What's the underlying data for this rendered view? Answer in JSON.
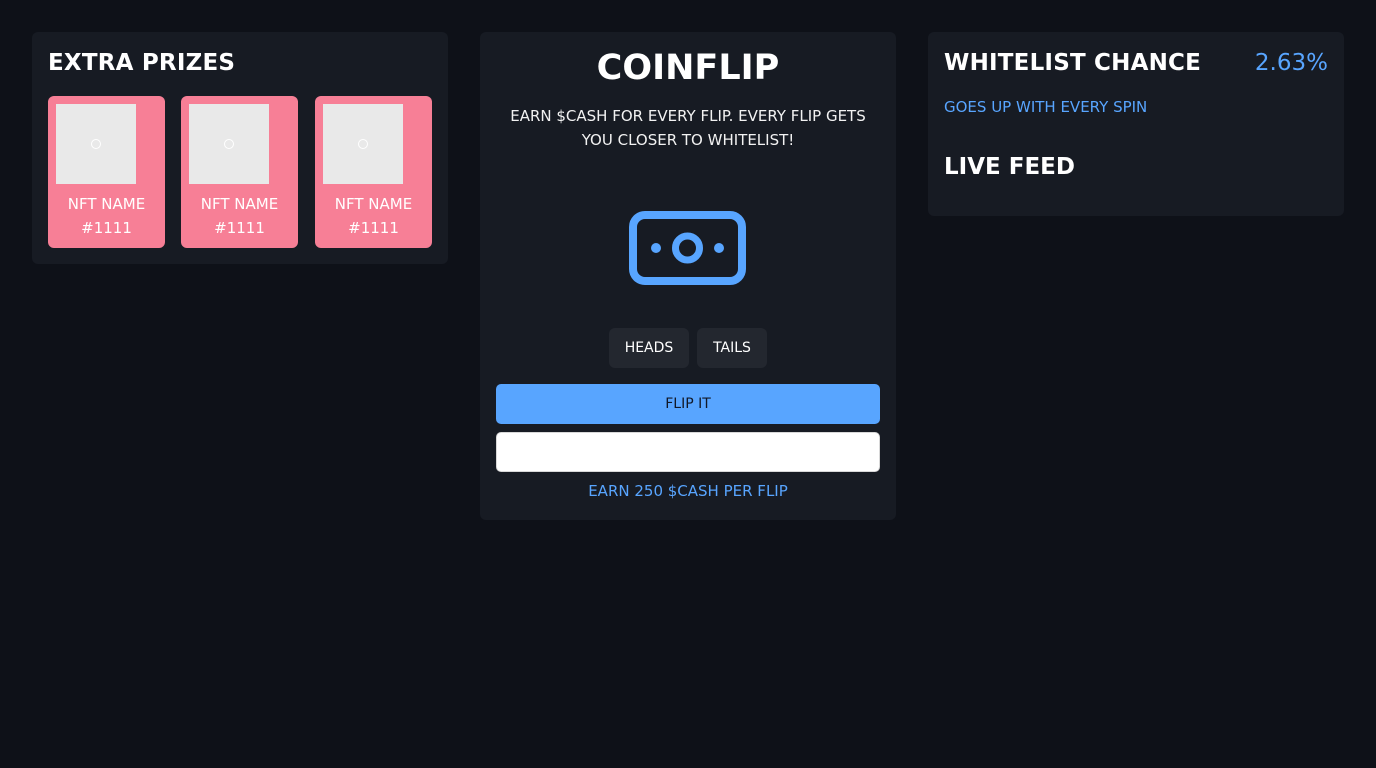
{
  "extra_prizes": {
    "title": "EXTRA PRIZES",
    "items": [
      {
        "name": "NFT NAME\n#1111",
        "image_icon": "image-placeholder-icon"
      },
      {
        "name": "NFT NAME\n#1111",
        "image_icon": "image-placeholder-icon"
      },
      {
        "name": "NFT NAME\n#1111",
        "image_icon": "image-placeholder-icon"
      }
    ]
  },
  "coinflip": {
    "title": "COINFLIP",
    "description": "EARN $CASH FOR EVERY FLIP. EVERY FLIP GETS YOU CLOSER TO WHITELIST!",
    "icon": "cash-icon",
    "choices": {
      "heads": "HEADS",
      "tails": "TAILS"
    },
    "flip_button": "FLIP IT",
    "input_value": "",
    "input_placeholder": "",
    "earn_note": "EARN 250 $CASH PER FLIP"
  },
  "whitelist": {
    "title": "WHITELIST CHANCE",
    "percent": "2.63%",
    "subtitle": "GOES UP WITH EVERY SPIN",
    "live_feed_title": "LIVE FEED"
  },
  "colors": {
    "background": "#0e1118",
    "panel": "#171b23",
    "accent": "#58a5ff",
    "prize_card": "#f77f96"
  }
}
